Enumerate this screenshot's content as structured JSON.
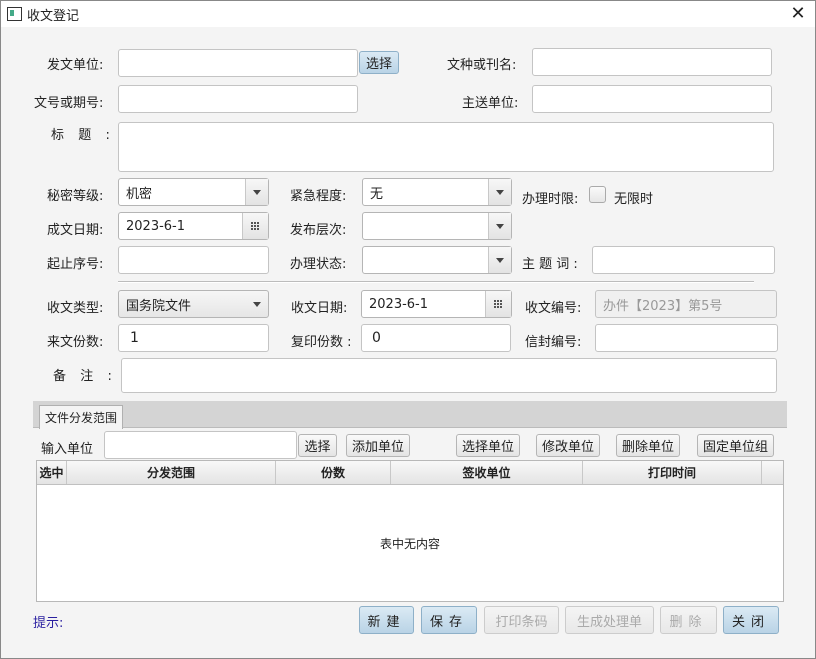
{
  "window": {
    "title": "收文登记",
    "close_glyph": "✕",
    "icon": "app-window-icon"
  },
  "form1": {
    "issuer_label": "发文单位:",
    "issuer_value": "",
    "select_button": "选择",
    "doc_type_label": "文种或刊名:",
    "doc_type_value": "",
    "doc_no_label": "文号或期号:",
    "doc_no_value": "",
    "main_recipient_label": "主送单位:",
    "main_recipient_value": "",
    "subject_label": "标  题  :",
    "subject_value": "",
    "secrecy_label": "秘密等级:",
    "secrecy_value": "机密",
    "urgency_label": "紧急程度:",
    "urgency_value": "无",
    "deadline_label": "办理时限:",
    "unlimited_label": "无限时",
    "unlimited_checked": false,
    "written_date_label": "成文日期:",
    "written_date_value": "2023-6-1",
    "publish_level_label": "发布层次:",
    "publish_level_value": "",
    "seq_label": "起止序号:",
    "seq_value": "",
    "status_label": "办理状态:",
    "status_value": "",
    "keywords_label": "主 题 词 :",
    "keywords_value": ""
  },
  "form2": {
    "recv_type_label": "收文类型:",
    "recv_type_value": "国务院文件",
    "recv_date_label": "收文日期:",
    "recv_date_value": "2023-6-1",
    "recv_no_label": "收文编号:",
    "recv_no_value": "办件【2023】第5号",
    "copies_label": "来文份数:",
    "copies_value": "1",
    "print_copies_label": "复印份数 :",
    "print_copies_value": "0",
    "envelope_label": "信封编号:",
    "envelope_value": "",
    "remark_label": "备  注  :",
    "remark_value": ""
  },
  "distribution": {
    "tab_label": "文件分发范围",
    "input_unit_label": "输入单位",
    "input_unit_value": "",
    "buttons": {
      "select": "选择",
      "add_unit": "添加单位",
      "choose_unit": "选择单位",
      "modify_unit": "修改单位",
      "delete_unit": "删除单位",
      "fixed_group": "固定单位组"
    },
    "columns": [
      "选中",
      "分发范围",
      "份数",
      "签收单位",
      "打印时间"
    ],
    "rows": [],
    "empty_text": "表中无内容"
  },
  "footer": {
    "hint_label": "提示:",
    "buttons": {
      "new": "新建",
      "save": "保存",
      "print_barcode": "打印条码",
      "gen_sheet": "生成处理单",
      "delete": "删除",
      "close": "关闭"
    }
  },
  "colors": {
    "hint": "#2a1fa0",
    "accent_button": "#b9d3e6"
  }
}
